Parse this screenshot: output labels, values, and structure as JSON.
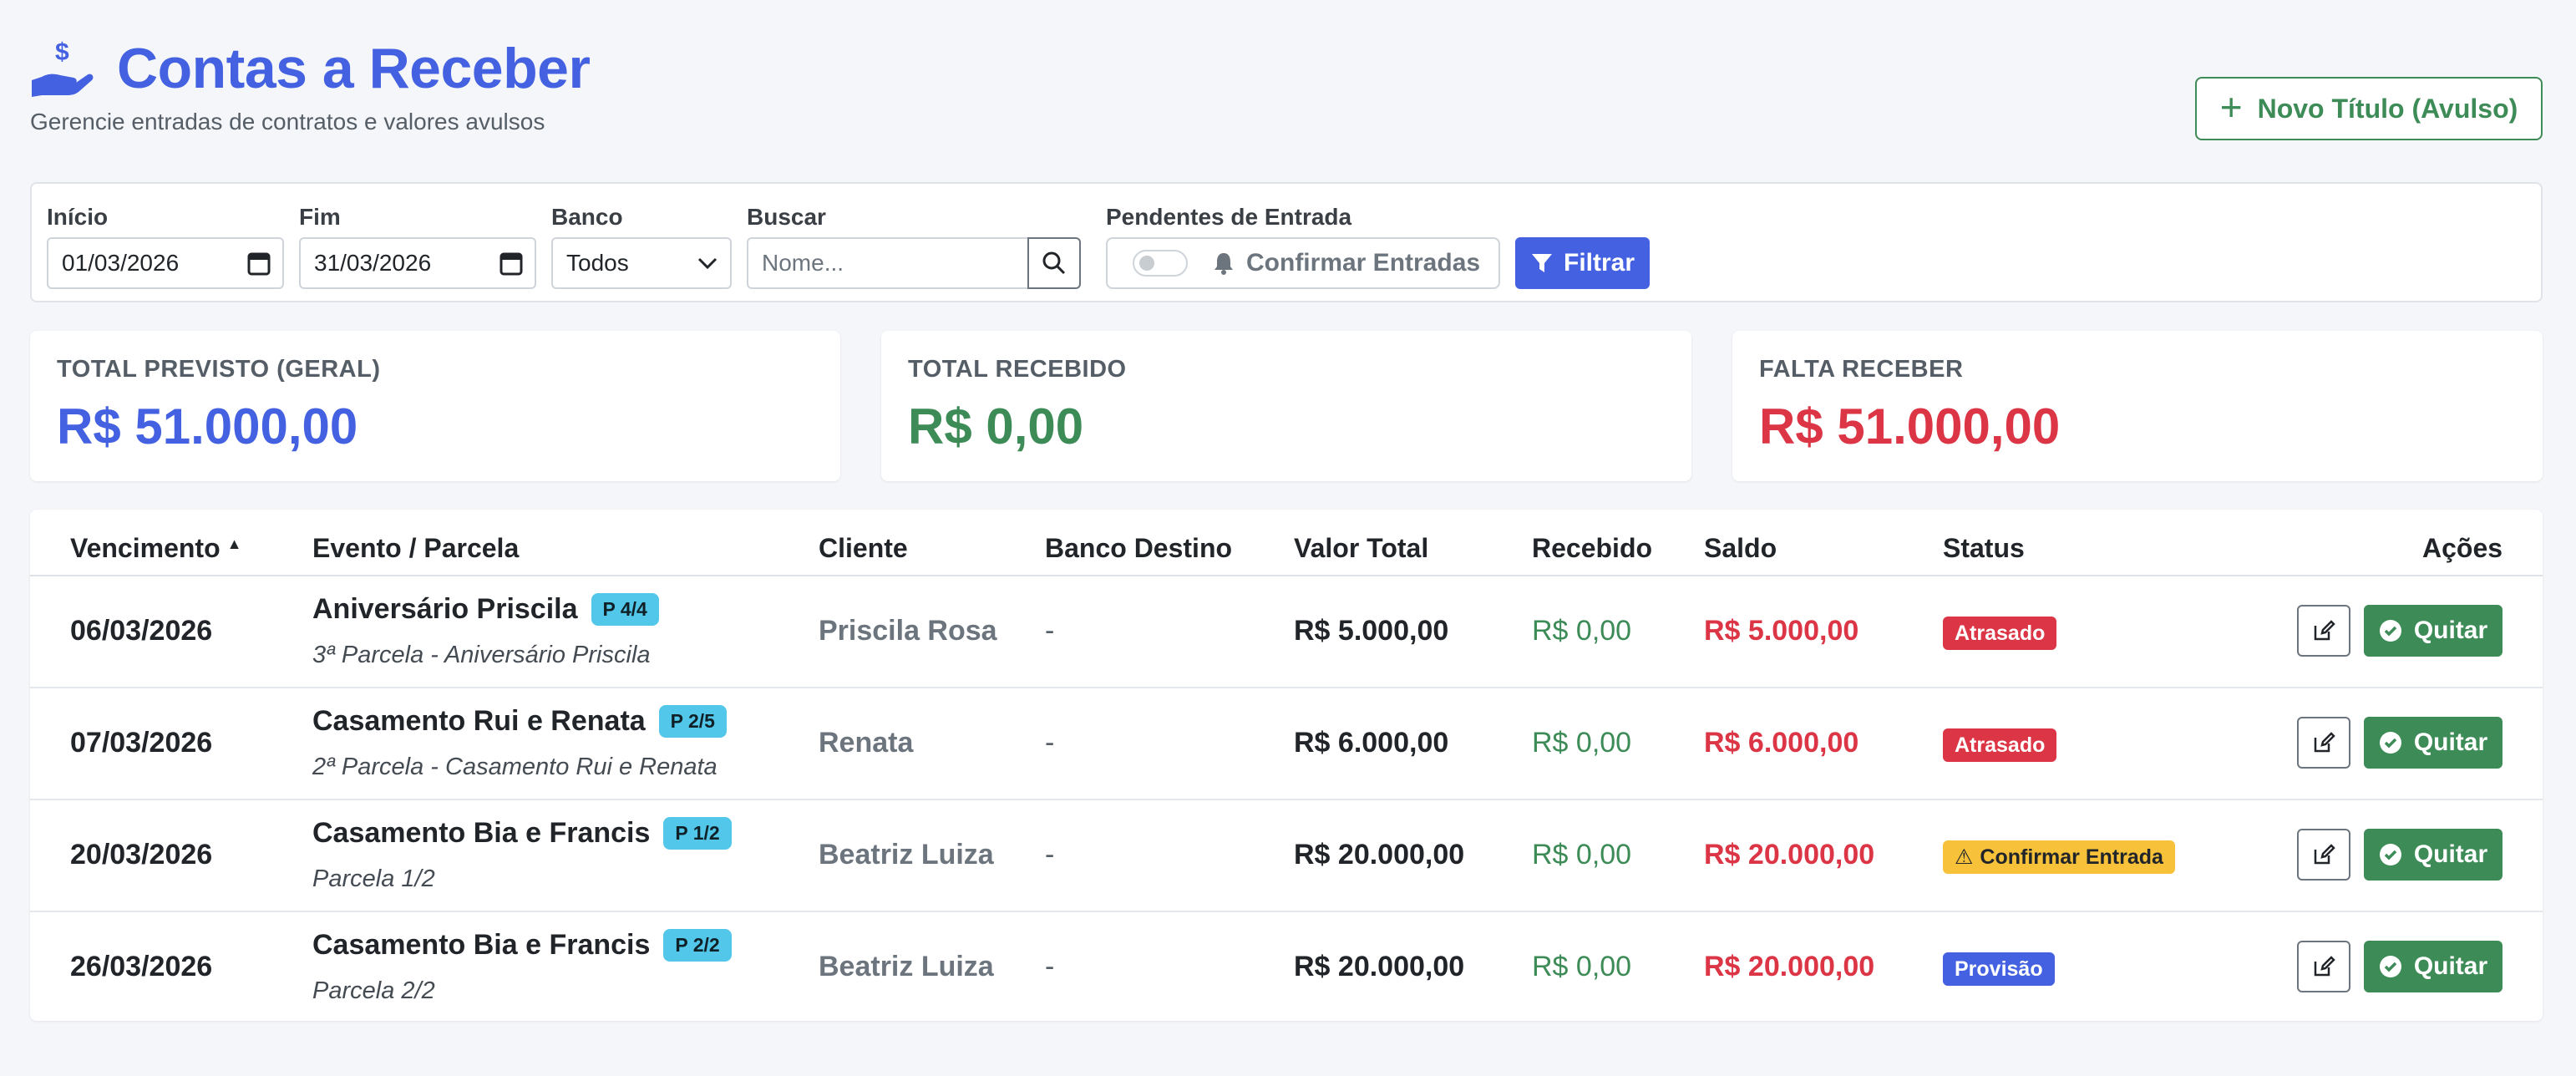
{
  "header": {
    "title": "Contas a Receber",
    "subtitle": "Gerencie entradas de contratos e valores avulsos",
    "new_button": "Novo Título (Avulso)"
  },
  "filters": {
    "start_label": "Início",
    "start_value": "01/03/2026",
    "end_label": "Fim",
    "end_value": "31/03/2026",
    "bank_label": "Banco",
    "bank_value": "Todos",
    "search_label": "Buscar",
    "search_placeholder": "Nome...",
    "pending_label": "Pendentes de Entrada",
    "pending_toggle_label": "Confirmar Entradas",
    "pending_toggle_on": false,
    "filter_button": "Filtrar"
  },
  "stats": [
    {
      "label": "TOTAL PREVISTO (GERAL)",
      "value": "R$ 51.000,00",
      "color": "#4361e0"
    },
    {
      "label": "TOTAL RECEBIDO",
      "value": "R$ 0,00",
      "color": "#3d8b57"
    },
    {
      "label": "FALTA RECEBER",
      "value": "R$ 51.000,00",
      "color": "#dc3545"
    }
  ],
  "table": {
    "columns": [
      "Vencimento",
      "Evento / Parcela",
      "Cliente",
      "Banco Destino",
      "Valor Total",
      "Recebido",
      "Saldo",
      "Status",
      "Ações"
    ],
    "sort_indicator": "▲",
    "rows": [
      {
        "due": "06/03/2026",
        "event": "Aniversário Priscila",
        "badge": "P 4/4",
        "sub": "3ª Parcela - Aniversário Priscila",
        "client": "Priscila Rosa",
        "bank": "-",
        "total": "R$ 5.000,00",
        "received": "R$ 0,00",
        "balance": "R$ 5.000,00",
        "status": "Atrasado",
        "status_bg": "#dc3545",
        "status_fg": "#ffffff",
        "status_icon": "",
        "action": "Quitar"
      },
      {
        "due": "07/03/2026",
        "event": "Casamento Rui e Renata",
        "badge": "P 2/5",
        "sub": "2ª Parcela - Casamento Rui e Renata",
        "client": "Renata",
        "bank": "-",
        "total": "R$ 6.000,00",
        "received": "R$ 0,00",
        "balance": "R$ 6.000,00",
        "status": "Atrasado",
        "status_bg": "#dc3545",
        "status_fg": "#ffffff",
        "status_icon": "",
        "action": "Quitar"
      },
      {
        "due": "20/03/2026",
        "event": "Casamento Bia e Francis",
        "badge": "P 1/2",
        "sub": "Parcela 1/2",
        "client": "Beatriz Luiza",
        "bank": "-",
        "total": "R$ 20.000,00",
        "received": "R$ 0,00",
        "balance": "R$ 20.000,00",
        "status": "Confirmar Entrada",
        "status_bg": "#f7c13a",
        "status_fg": "#212529",
        "status_icon": "⚠",
        "action": "Quitar"
      },
      {
        "due": "26/03/2026",
        "event": "Casamento Bia e Francis",
        "badge": "P 2/2",
        "sub": "Parcela 2/2",
        "client": "Beatriz Luiza",
        "bank": "-",
        "total": "R$ 20.000,00",
        "received": "R$ 0,00",
        "balance": "R$ 20.000,00",
        "status": "Provisão",
        "status_bg": "#4361e0",
        "status_fg": "#ffffff",
        "status_icon": "",
        "action": "Quitar"
      }
    ]
  }
}
